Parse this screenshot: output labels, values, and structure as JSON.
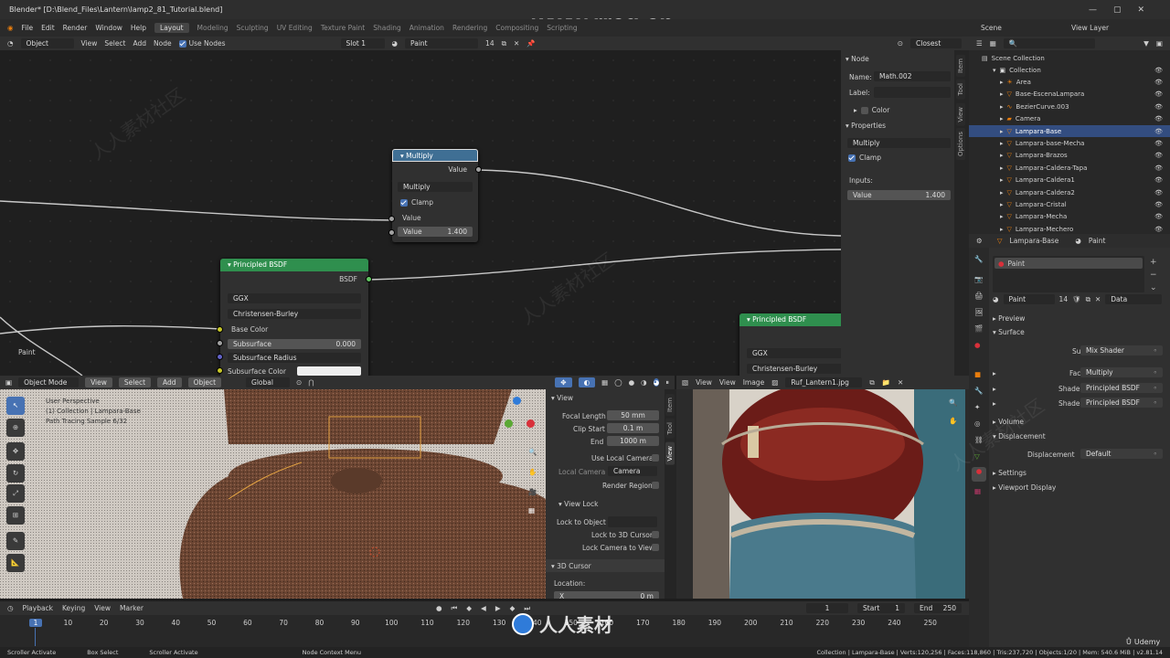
{
  "title_bar": {
    "title": "Blender* [D:\\Blend_Files\\Lantern\\lamp2_81_Tutorial.blend]",
    "watermark": "www.rrcg.cn"
  },
  "top_bar": {
    "menus": [
      "File",
      "Edit",
      "Render",
      "Window",
      "Help"
    ],
    "workspaces": [
      "Layout",
      "Modeling",
      "Sculpting",
      "UV Editing",
      "Texture Paint",
      "Shading",
      "Animation",
      "Rendering",
      "Compositing",
      "Scripting"
    ],
    "scene": "Scene",
    "view_layer": "View Layer"
  },
  "node_header": {
    "mode": "Object",
    "menus": [
      "View",
      "Select",
      "Add",
      "Node"
    ],
    "use_nodes": "Use Nodes",
    "slot": "Slot 1",
    "material": "Paint",
    "users": "14",
    "snap": "Closest"
  },
  "multiply_node": {
    "title": "Multiply",
    "out": "Value",
    "op": "Multiply",
    "clamp": "Clamp",
    "in1": "Value",
    "in2_label": "Value",
    "in2_value": "1.400"
  },
  "bsdf_node": {
    "title": "Principled BSDF",
    "out": "BSDF",
    "dist": "GGX",
    "sss": "Christensen-Burley",
    "base": "Base Color",
    "subsurface": "Subsurface",
    "subsurface_value": "0.000",
    "radius": "Subsurface Radius",
    "sscolor": "Subsurface Color"
  },
  "bsdf_node2": {
    "title": "Principled BSDF",
    "dist": "GGX",
    "sss": "Christensen-Burley"
  },
  "frame_label": "Paint",
  "node_sidebar": {
    "node_section": "Node",
    "name_label": "Name:",
    "name_value": "Math.002",
    "label_label": "Label:",
    "color": "Color",
    "props": "Properties",
    "op": "Multiply",
    "clamp": "Clamp",
    "inputs": "Inputs:",
    "value_label": "Value",
    "value": "1.400",
    "tabs": [
      "Item",
      "Tool",
      "View",
      "Options"
    ]
  },
  "viewport": {
    "mode": "Object Mode",
    "menus": [
      "View",
      "Select",
      "Add",
      "Object"
    ],
    "orient": "Global",
    "overlay1": "User Perspective",
    "overlay2": "(1) Collection | Lampara-Base",
    "overlay3": "Path Tracing Sample 6/32"
  },
  "view_panel": {
    "section": "View",
    "focal_label": "Focal Length",
    "focal": "50 mm",
    "clip_start_label": "Clip Start",
    "clip_start": "0.1 m",
    "end_label": "End",
    "end": "1000 m",
    "local_cam": "Use Local Camera",
    "local_cam_label": "Local Camera",
    "camera": "Camera",
    "render_region": "Render Region",
    "view_lock": "View Lock",
    "lock_obj": "Lock to Object",
    "lock_3d": "Lock to 3D Cursor",
    "lock_cam": "Lock Camera to View",
    "cursor": "3D Cursor",
    "location": "Location:",
    "x_label": "X",
    "x": "0 m",
    "tabs": [
      "Item",
      "Tool",
      "View"
    ]
  },
  "image_editor": {
    "menus": [
      "View",
      "View",
      "Image"
    ],
    "image": "Ruf_Lantern1.jpg"
  },
  "outliner": {
    "root": "Scene Collection",
    "items": [
      {
        "name": "Collection",
        "type": "collection"
      },
      {
        "name": "Area",
        "type": "light"
      },
      {
        "name": "Base-EscenaLampara",
        "type": "mesh"
      },
      {
        "name": "BezierCurve.003",
        "type": "curve"
      },
      {
        "name": "Camera",
        "type": "camera"
      },
      {
        "name": "Lampara-Base",
        "type": "mesh",
        "selected": true
      },
      {
        "name": "Lampara-base-Mecha",
        "type": "mesh"
      },
      {
        "name": "Lampara-Brazos",
        "type": "mesh"
      },
      {
        "name": "Lampara-Caldera-Tapa",
        "type": "mesh"
      },
      {
        "name": "Lampara-Caldera1",
        "type": "mesh"
      },
      {
        "name": "Lampara-Caldera2",
        "type": "mesh"
      },
      {
        "name": "Lampara-Cristal",
        "type": "mesh"
      },
      {
        "name": "Lampara-Mecha",
        "type": "mesh"
      },
      {
        "name": "Lampara-Mechero",
        "type": "mesh"
      }
    ]
  },
  "properties": {
    "object": "Lampara-Base",
    "material": "Paint",
    "slot": "Paint",
    "mat_name": "Paint",
    "users": "14",
    "data": "Data",
    "preview": "Preview",
    "surface_section": "Surface",
    "surface_label": "Surface",
    "surface": "Mix Shader",
    "fac_label": "Fac",
    "fac": "Multiply",
    "shader1_label": "Shader",
    "shader1": "Principled BSDF",
    "shader2_label": "Shader",
    "shader2": "Principled BSDF",
    "volume": "Volume",
    "displacement_section": "Displacement",
    "disp_label": "Displacement",
    "disp": "Default",
    "settings": "Settings",
    "viewport_display": "Viewport Display"
  },
  "timeline": {
    "menus": [
      "Playback",
      "Keying",
      "View",
      "Marker"
    ],
    "current": "1",
    "start_label": "Start",
    "start": "1",
    "end_label": "End",
    "end": "250",
    "ticks": [
      "1",
      "10",
      "20",
      "30",
      "40",
      "50",
      "60",
      "70",
      "80",
      "90",
      "100",
      "110",
      "120",
      "130",
      "140",
      "150",
      "160",
      "170",
      "180",
      "190",
      "200",
      "210",
      "220",
      "230",
      "240",
      "250"
    ]
  },
  "status": {
    "left1": "Scroller Activate",
    "left2": "Box Select",
    "left3": "Scroller Activate",
    "mid": "Node Context Menu",
    "stats": "Collection | Lampara-Base | Verts:120,256 | Faces:118,860 | Tris:237,720 | Objects:1/20 | Mem: 540.6 MiB | v2.81.14"
  },
  "watermarks": {
    "cn": "人人素材社区",
    "logo": "人人素材",
    "udemy": "Udemy"
  }
}
